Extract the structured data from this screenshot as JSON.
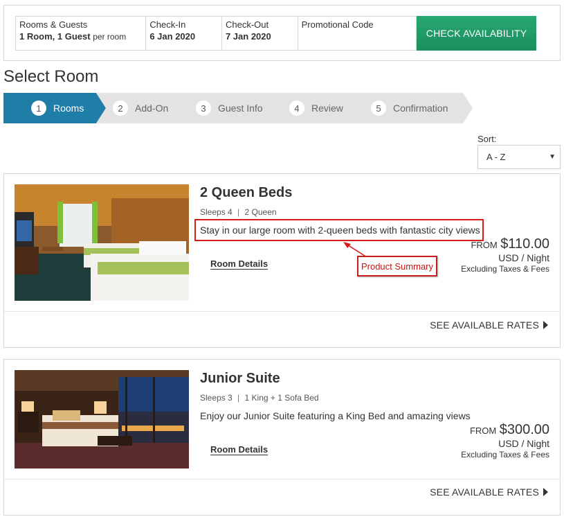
{
  "search": {
    "rooms_label": "Rooms & Guests",
    "rooms_value": "1 Room, 1 Guest",
    "rooms_sub": "per room",
    "checkin_label": "Check-In",
    "checkin_value": "6 Jan 2020",
    "checkout_label": "Check-Out",
    "checkout_value": "7 Jan 2020",
    "promo_label": "Promotional Code",
    "promo_value": "",
    "button": "CHECK AVAILABILITY",
    "button_color": "#21a06b"
  },
  "page_title": "Select Room",
  "steps": [
    {
      "num": "1",
      "label": "Rooms",
      "active": true
    },
    {
      "num": "2",
      "label": "Add-On"
    },
    {
      "num": "3",
      "label": "Guest Info"
    },
    {
      "num": "4",
      "label": "Review"
    },
    {
      "num": "5",
      "label": "Confirmation"
    }
  ],
  "active_step_color": "#1e7ea8",
  "sort": {
    "label": "Sort:",
    "value": "A - Z"
  },
  "rooms": [
    {
      "name": "2 Queen Beds",
      "sleeps": "Sleeps 4",
      "beds": "2 Queen",
      "description": "Stay in our large room with 2-queen beds with fantastic city views",
      "details_link": "Room Details",
      "from": "FROM",
      "price": "$110.00",
      "unit": "USD / Night",
      "taxes": "Excluding Taxes & Fees",
      "rates_link": "SEE AVAILABLE RATES"
    },
    {
      "name": "Junior Suite",
      "sleeps": "Sleeps 3",
      "beds": "1 King + 1 Sofa Bed",
      "description": "Enjoy our Junior Suite featuring a King Bed and amazing views",
      "details_link": "Room Details",
      "from": "FROM",
      "price": "$300.00",
      "unit": "USD / Night",
      "taxes": "Excluding Taxes & Fees",
      "rates_link": "SEE AVAILABLE RATES"
    }
  ],
  "annotation": {
    "label": "Product Summary",
    "color": "#d81c1c"
  }
}
